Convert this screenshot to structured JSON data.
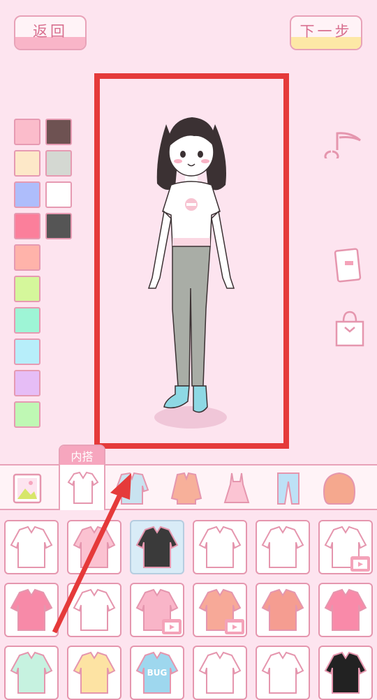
{
  "header": {
    "back_label": "返回",
    "next_label": "下一步"
  },
  "palette": {
    "colors": [
      "#fbbccb",
      "#6e5252",
      "#fde8c8",
      "#d4d8d2",
      "#aebdfb",
      "#ffffff",
      "#fb7f9b",
      "#555555",
      "#ffb3aa",
      "#d5f79b",
      "#9ef5d6",
      "#b7eefa",
      "#e6bdf6",
      "#bff8b4"
    ]
  },
  "side_icons": [
    "music-note-icon",
    "notebook-icon",
    "shopping-bag-icon"
  ],
  "categories": {
    "active_label": "内搭",
    "items": [
      "background-icon",
      "inner-top-icon",
      "jacket-icon",
      "coat-icon",
      "dress-icon",
      "pants-icon",
      "hair-icon"
    ]
  },
  "items": {
    "rows": [
      [
        {
          "name": "white-tshirt-drop-item"
        },
        {
          "name": "pink-turtleneck-item"
        },
        {
          "name": "black-trash-tshirt-item",
          "selected": true
        },
        {
          "name": "white-ruffle-blouse-item"
        },
        {
          "name": "white-longsleeve-item"
        },
        {
          "name": "sailor-top-item",
          "video": true
        }
      ],
      [
        {
          "name": "pink-cardigan-item"
        },
        {
          "name": "white-longsleeve-2-item"
        },
        {
          "name": "pink-knit-sweater-item",
          "video": true
        },
        {
          "name": "bunny-sweater-item",
          "video": true
        },
        {
          "name": "coral-jacket-item"
        },
        {
          "name": "star-crop-top-item"
        }
      ],
      [
        {
          "name": "mint-top-item"
        },
        {
          "name": "yellow-top-item"
        },
        {
          "name": "bug-tshirt-item",
          "text": "BUG"
        },
        {
          "name": "white-top-item"
        },
        {
          "name": "white-top-2-item"
        },
        {
          "name": "black-top-item"
        }
      ]
    ]
  }
}
